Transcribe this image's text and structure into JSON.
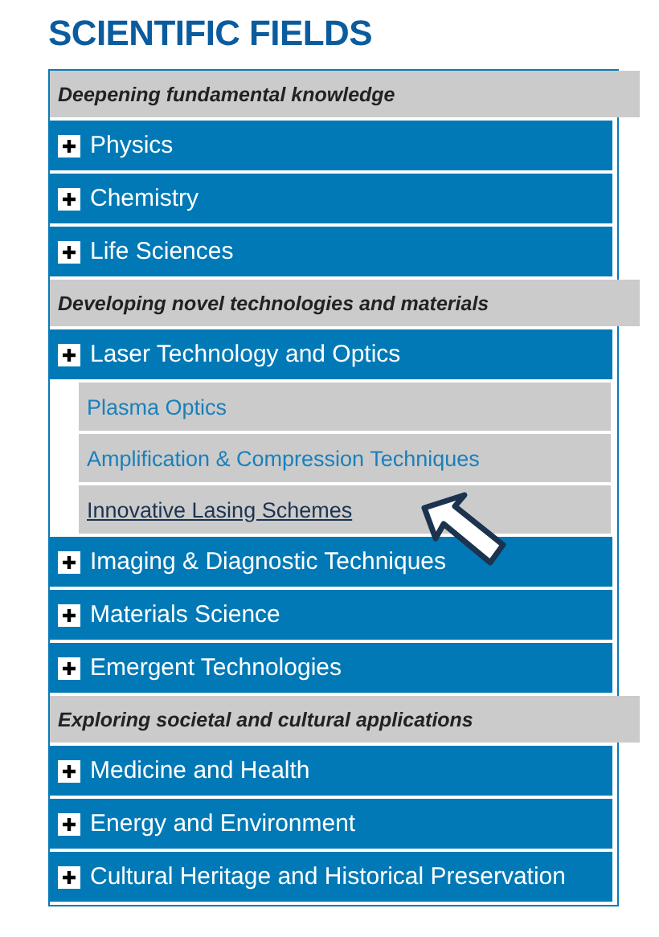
{
  "title": "SCIENTIFIC FIELDS",
  "sections": [
    {
      "heading": "Deepening fundamental knowledge",
      "fields": [
        {
          "label": "Physics"
        },
        {
          "label": "Chemistry"
        },
        {
          "label": "Life Sciences"
        }
      ]
    },
    {
      "heading": "Developing novel technologies and materials",
      "fields": [
        {
          "label": "Laser Technology and Optics",
          "children": [
            {
              "label": "Plasma Optics",
              "hovered": false
            },
            {
              "label": "Amplification & Compression Techniques",
              "hovered": false
            },
            {
              "label": "Innovative Lasing Schemes",
              "hovered": true
            }
          ]
        },
        {
          "label": "Imaging & Diagnostic Techniques"
        },
        {
          "label": "Materials Science"
        },
        {
          "label": "Emergent Technologies"
        }
      ]
    },
    {
      "heading": "Exploring societal and cultural applications",
      "fields": [
        {
          "label": "Medicine and Health"
        },
        {
          "label": "Energy and Environment"
        },
        {
          "label": "Cultural Heritage and Historical Preservation"
        }
      ]
    }
  ]
}
